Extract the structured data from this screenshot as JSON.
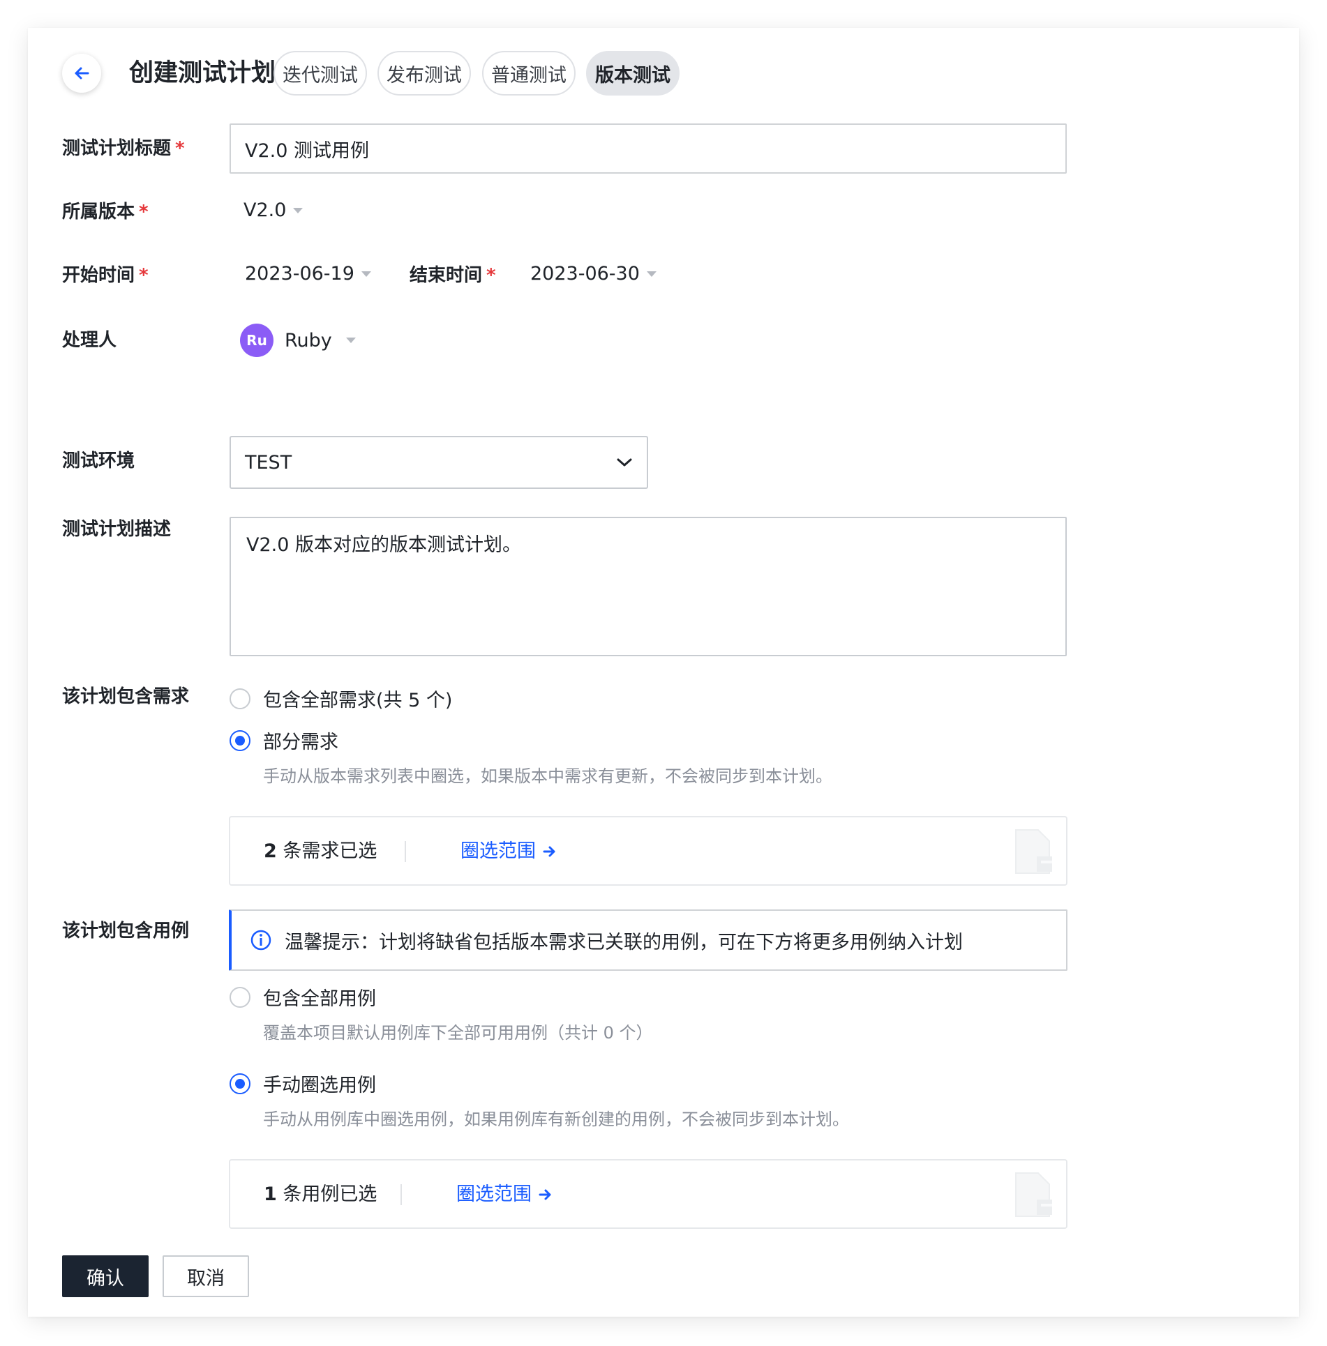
{
  "header": {
    "title": "创建测试计划",
    "tabs": [
      {
        "label": "迭代测试",
        "active": false
      },
      {
        "label": "发布测试",
        "active": false
      },
      {
        "label": "普通测试",
        "active": false
      },
      {
        "label": "版本测试",
        "active": true
      }
    ]
  },
  "form": {
    "title": {
      "label": "测试计划标题",
      "required": "*",
      "value": "V2.0 测试用例"
    },
    "version": {
      "label": "所属版本",
      "required": "*",
      "value": "V2.0"
    },
    "start": {
      "label": "开始时间",
      "required": "*",
      "value": "2023-06-19"
    },
    "end": {
      "label": "结束时间",
      "required": "*",
      "value": "2023-06-30"
    },
    "assignee": {
      "label": "处理人",
      "avatar_initials": "Ru",
      "avatar_color": "#8b5cf6",
      "value": "Ruby"
    },
    "env": {
      "label": "测试环境",
      "value": "TEST"
    },
    "description": {
      "label": "测试计划描述",
      "value": "V2.0 版本对应的版本测试计划。"
    },
    "requirements": {
      "label": "该计划包含需求",
      "options": [
        {
          "label": "包含全部需求(共 5 个)",
          "checked": false
        },
        {
          "label": "部分需求",
          "checked": true
        }
      ],
      "hint": "手动从版本需求列表中圈选，如果版本中需求有更新，不会被同步到本计划。",
      "selected_count": "2",
      "selected_text": "条需求已选",
      "scope_link": "圈选范围"
    },
    "cases": {
      "label": "该计划包含用例",
      "notice": "温馨提示：计划将缺省包括版本需求已关联的用例，可在下方将更多用例纳入计划",
      "options": [
        {
          "label": "包含全部用例",
          "checked": false,
          "hint": "覆盖本项目默认用例库下全部可用用例（共计 0 个）"
        },
        {
          "label": "手动圈选用例",
          "checked": true,
          "hint": "手动从用例库中圈选用例，如果用例库有新创建的用例，不会被同步到本计划。"
        }
      ],
      "selected_count": "1",
      "selected_text": "条用例已选",
      "scope_link": "圈选范围"
    }
  },
  "actions": {
    "confirm": "确认",
    "cancel": "取消"
  },
  "colors": {
    "accent": "#1a5cff",
    "required": "#e5383b",
    "primary_button": "#1b2431"
  }
}
